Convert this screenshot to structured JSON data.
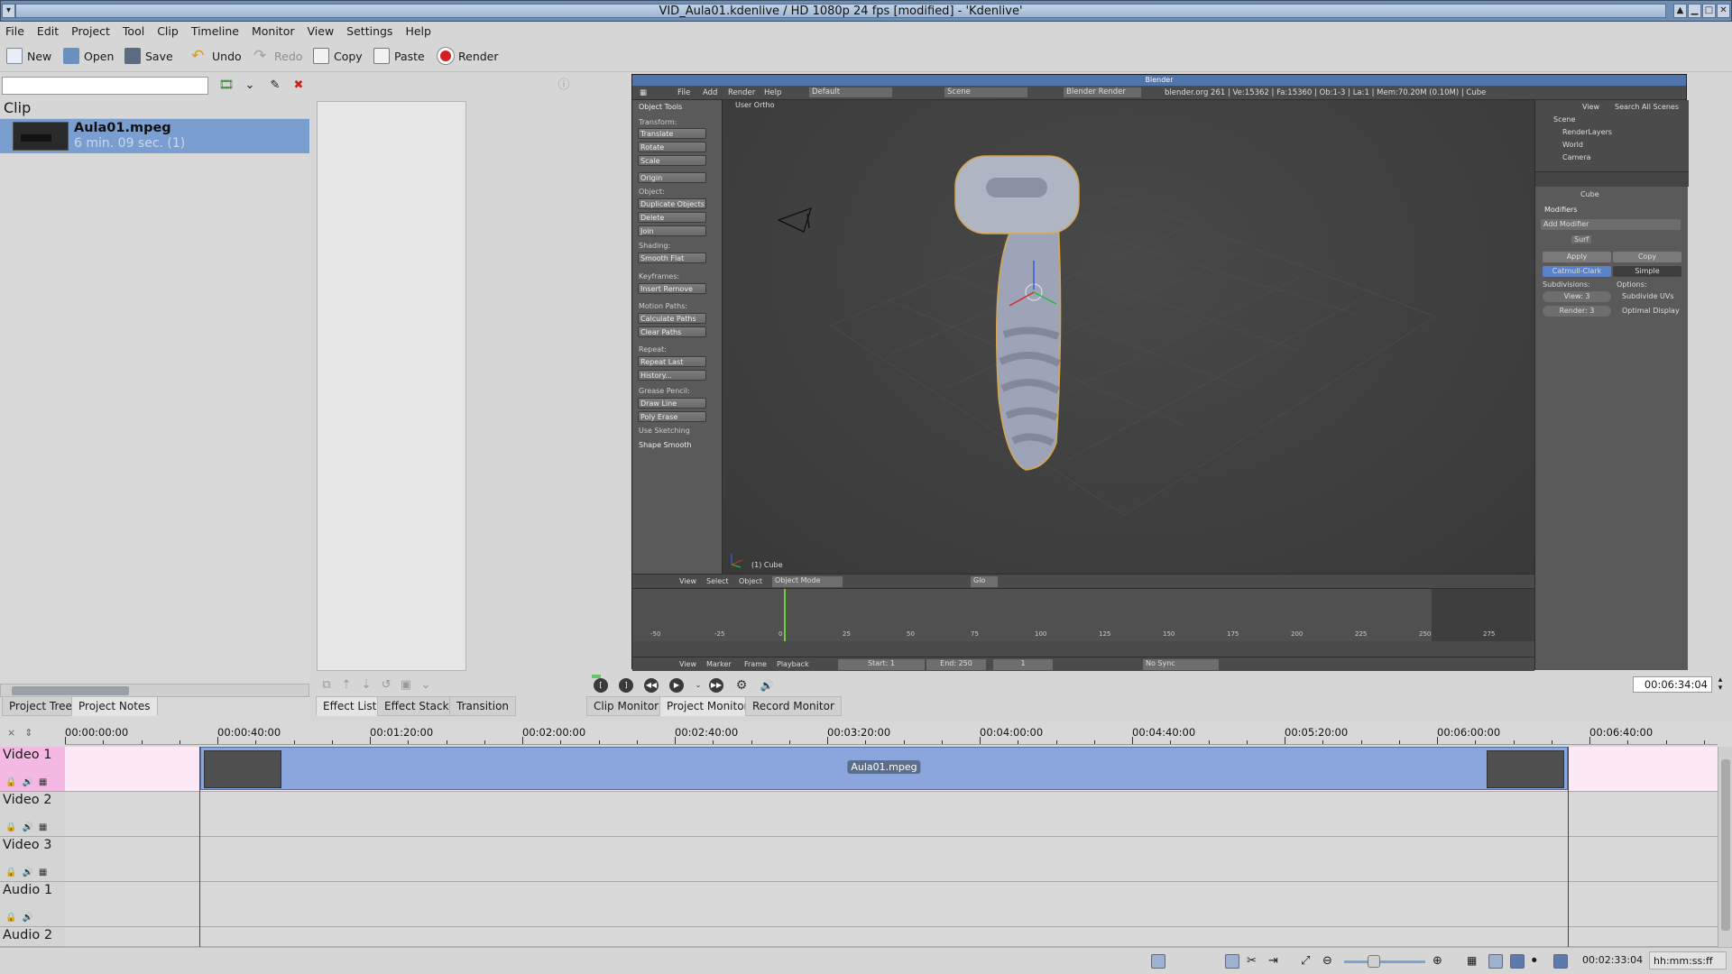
{
  "window": {
    "title": "VID_Aula01.kdenlive / HD 1080p 24 fps [modified] - 'Kdenlive'",
    "controls": [
      "▲",
      "▁",
      "□",
      "✕"
    ]
  },
  "menu": [
    "File",
    "Edit",
    "Project",
    "Tool",
    "Clip",
    "Timeline",
    "Monitor",
    "View",
    "Settings",
    "Help"
  ],
  "toolbar": {
    "new": "New",
    "open": "Open",
    "save": "Save",
    "undo": "Undo",
    "redo": "Redo",
    "copy": "Copy",
    "paste": "Paste",
    "render": "Render"
  },
  "project_bin": {
    "search_value": "",
    "header": "Clip",
    "clips": [
      {
        "name": "Aula01.mpeg",
        "duration": "6 min. 09 sec. (1)"
      }
    ]
  },
  "panel_tabs": {
    "project_tree": "Project Tree",
    "project_notes": "Project Notes",
    "effect_list": "Effect List",
    "effect_stack": "Effect Stack",
    "transition": "Transition",
    "clip_monitor": "Clip Monitor",
    "project_monitor": "Project Monitor",
    "record_monitor": "Record Monitor"
  },
  "monitor": {
    "timecode": "00:06:34:04",
    "blender": {
      "title": "Blender",
      "header_menu": [
        "File",
        "Add",
        "Render",
        "Help"
      ],
      "layout": "Default",
      "scene": "Scene",
      "engine": "Blender Render",
      "info": "blender.org 261 | Ve:15362 | Fa:15360 | Ob:1-3 | La:1 | Mem:70.20M (0.10M) | Cube",
      "view_label": "User Ortho",
      "object_label": "(1) Cube",
      "tools": {
        "title": "Object Tools",
        "transform": "Transform:",
        "translate": "Translate",
        "rotate": "Rotate",
        "scale": "Scale",
        "origin": "Origin",
        "object": "Object:",
        "duplicate": "Duplicate Objects",
        "delete": "Delete",
        "join": "Join",
        "shading": "Shading:",
        "smooth_flat": "Smooth   Flat",
        "keyframes": "Keyframes:",
        "insert_remove": "Insert     Remove",
        "motion_paths": "Motion Paths:",
        "calc_paths": "Calculate Paths",
        "clear_paths": "Clear Paths",
        "repeat": "Repeat:",
        "repeat_last": "Repeat Last",
        "history": "History...",
        "grease": "Grease Pencil:",
        "draw_line": "Draw      Line",
        "poly_erase": "Poly      Erase",
        "use_sketching": "Use Sketching",
        "shape_smooth": "Shape Smooth"
      },
      "outliner": {
        "view": "View",
        "search": "Search",
        "all_scenes": "All Scenes",
        "items": [
          "Scene",
          "RenderLayers",
          "World",
          "Camera"
        ]
      },
      "props": {
        "object_name": "Cube",
        "modifiers": "Modifiers",
        "add_modifier": "Add Modifier",
        "mod_name": "Surf",
        "apply": "Apply",
        "copy": "Copy",
        "catmull": "Catmull-Clark",
        "simple": "Simple",
        "subdivisions": "Subdivisions:",
        "options": "Options:",
        "view_level": "View: 3",
        "render_level": "Render: 3",
        "subdivide_uvs": "Subdivide UVs",
        "optimal_display": "Optimal Display"
      },
      "view3d_menu": [
        "View",
        "Select",
        "Object"
      ],
      "mode": "Object Mode",
      "global": "Glo",
      "timeline_menu": [
        "View",
        "Marker",
        "Frame",
        "Playback"
      ],
      "start": "Start: 1",
      "end": "End: 250",
      "frame": "1",
      "sync": "No Sync",
      "frame_ticks": [
        "-50",
        "-25",
        "0",
        "25",
        "50",
        "75",
        "100",
        "125",
        "150",
        "175",
        "200",
        "225",
        "250",
        "275"
      ]
    }
  },
  "timeline": {
    "ruler": [
      "00:00:00:00",
      "00:00:40:00",
      "00:01:20:00",
      "00:02:00:00",
      "00:02:40:00",
      "00:03:20:00",
      "00:04:00:00",
      "00:04:40:00",
      "00:05:20:00",
      "00:06:00:00",
      "00:06:40:00"
    ],
    "tracks": [
      "Video 1",
      "Video 2",
      "Video 3",
      "Audio 1",
      "Audio 2"
    ],
    "clip_label": "Aula01.mpeg"
  },
  "status": {
    "timecode": "00:02:33:04",
    "format": "hh:mm:ss:ff"
  },
  "colors": {
    "accent": "#7b9ed0",
    "clip": "#8aa6dc",
    "video1_track": "#fde8f6"
  }
}
